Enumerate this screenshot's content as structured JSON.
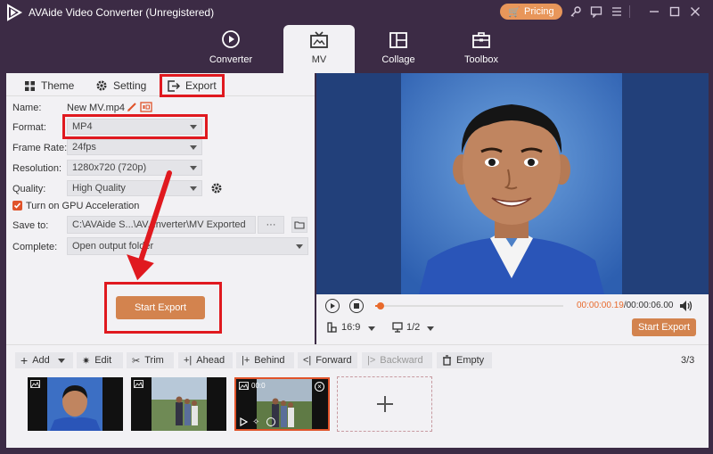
{
  "app": {
    "title": "AVAide Video Converter (Unregistered)",
    "pricing_label": "Pricing"
  },
  "window_icons": [
    "key-icon",
    "chat-icon",
    "menu-icon",
    "minimize-icon",
    "maximize-icon",
    "close-icon"
  ],
  "main_tabs": [
    {
      "label": "Converter",
      "icon": "converter-icon",
      "active": false
    },
    {
      "label": "MV",
      "icon": "mv-icon",
      "active": true
    },
    {
      "label": "Collage",
      "icon": "collage-icon",
      "active": false
    },
    {
      "label": "Toolbox",
      "icon": "toolbox-icon",
      "active": false
    }
  ],
  "sub_tabs": [
    {
      "label": "Theme",
      "icon": "theme-icon"
    },
    {
      "label": "Setting",
      "icon": "gear-icon"
    },
    {
      "label": "Export",
      "icon": "export-icon",
      "active": true
    }
  ],
  "export_form": {
    "name_label": "Name:",
    "name_value": "New MV.mp4",
    "format_label": "Format:",
    "format_value": "MP4",
    "frame_rate_label": "Frame Rate:",
    "frame_rate_value": "24fps",
    "resolution_label": "Resolution:",
    "resolution_value": "1280x720 (720p)",
    "quality_label": "Quality:",
    "quality_value": "High Quality",
    "gpu_label": "Turn on GPU Acceleration",
    "gpu_checked": true,
    "save_to_label": "Save to:",
    "save_to_value": "C:\\AVAide S...\\AV...nverter\\MV Exported",
    "browse_label": "···",
    "complete_label": "Complete:",
    "complete_value": "Open output folder",
    "start_export_label": "Start Export"
  },
  "player": {
    "current_time": "00:00:00.19",
    "separator": "/",
    "total_time": "00:00:06.00",
    "progress": 0.03,
    "aspect_ratio": "16:9",
    "display_ratio": "1/2",
    "start_export_label": "Start Export"
  },
  "toolbar": {
    "add": "Add",
    "edit": "Edit",
    "trim": "Trim",
    "ahead": "Ahead",
    "behind": "Behind",
    "forward": "Forward",
    "backward": "Backward",
    "empty": "Empty",
    "count": "3/3"
  },
  "thumbnails": [
    {
      "subject": "boy-portrait"
    },
    {
      "subject": "group-outdoor"
    },
    {
      "subject": "group-outdoor-selected",
      "selected": true,
      "time": "00:0"
    }
  ],
  "colors": {
    "accent": "#d3834e",
    "pricing": "#e8965a",
    "highlight_red": "#e0191f",
    "titlebar": "#3c2b45",
    "time_orange": "#e86a2c"
  }
}
